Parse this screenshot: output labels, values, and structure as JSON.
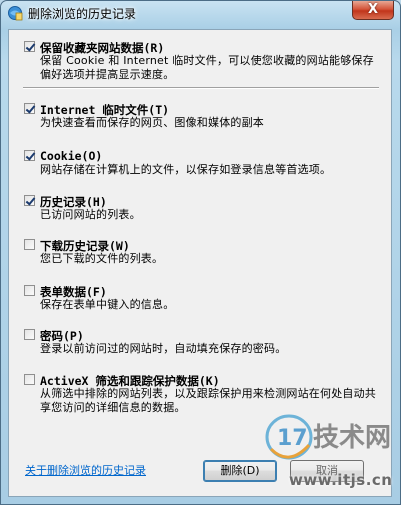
{
  "window": {
    "title": "删除浏览的历史记录",
    "close_symbol": "X"
  },
  "options": [
    {
      "label": "保留收藏夹网站数据(R)",
      "checked": true,
      "description": "保留 Cookie 和 Internet 临时文件，可以使您收藏的网站能够保存偏好选项并提高显示速度。"
    },
    {
      "label": "Internet 临时文件(T)",
      "checked": true,
      "description": "为快速查看而保存的网页、图像和媒体的副本"
    },
    {
      "label": "Cookie(O)",
      "checked": true,
      "description": "网站存储在计算机上的文件，以保存如登录信息等首选项。"
    },
    {
      "label": "历史记录(H)",
      "checked": true,
      "description": "已访问网站的列表。"
    },
    {
      "label": "下载历史记录(W)",
      "checked": false,
      "description": "您已下载的文件的列表。"
    },
    {
      "label": "表单数据(F)",
      "checked": false,
      "description": "保存在表单中键入的信息。"
    },
    {
      "label": "密码(P)",
      "checked": false,
      "description": "登录以前访问过的网站时，自动填充保存的密码。"
    },
    {
      "label": "ActiveX 筛选和跟踪保护数据(K)",
      "checked": false,
      "description": "从筛选中排除的网站列表，以及跟踪保护用来检测网站在何处自动共享您访问的详细信息的数据。"
    }
  ],
  "footer": {
    "link_text": "关于删除浏览的历史记录",
    "delete_label": "删除(D)",
    "cancel_label": "取消"
  },
  "watermark": {
    "logo_number": "17",
    "logo_text": "技术网",
    "url": "www.itjs.cn"
  },
  "colors": {
    "link": "#0066cc",
    "close_button": "#c1351b",
    "watermark": "#8a8a8a"
  },
  "icons": [
    "ie-history-icon",
    "close-icon",
    "checkbox-icon"
  ]
}
